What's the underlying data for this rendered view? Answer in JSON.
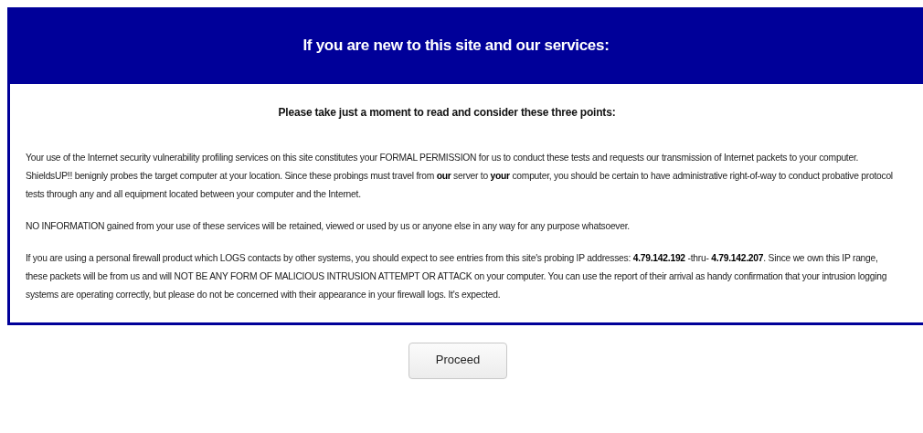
{
  "header": {
    "title": "If you are new to this site and our services:"
  },
  "notice": {
    "heading": "Please take just a moment to read and consider these three points:",
    "paragraphs": [
      "Your use of the Internet security vulnerability profiling services on this site constitutes your FORMAL PERMISSION for us to conduct these tests and requests our transmission of Internet packets to your computer. ShieldsUP!! benignly probes the target computer at your location. Since these probings must travel from **our** server to **your** computer, you should be certain to have administrative right-of-way to conduct probative protocol tests through any and all equipment located between your computer and the Internet.",
      "NO INFORMATION gained from your use of these services will be retained, viewed or used by us or anyone else in any way for any purpose whatsoever.",
      "If you are using a personal firewall product which LOGS contacts by other systems, you should expect to see entries from this site's probing IP addresses: **4.79.142.192** -thru- **4.79.142.207**. Since we own this IP range, these packets will be from us and will NOT BE ANY FORM OF MALICIOUS INTRUSION ATTEMPT OR ATTACK on your computer. You can use the report of their arrival as handy confirmation that your intrusion logging systems are operating correctly, but please do not be concerned with their appearance in your firewall logs. It's expected."
    ]
  },
  "button": {
    "label": "Proceed"
  }
}
